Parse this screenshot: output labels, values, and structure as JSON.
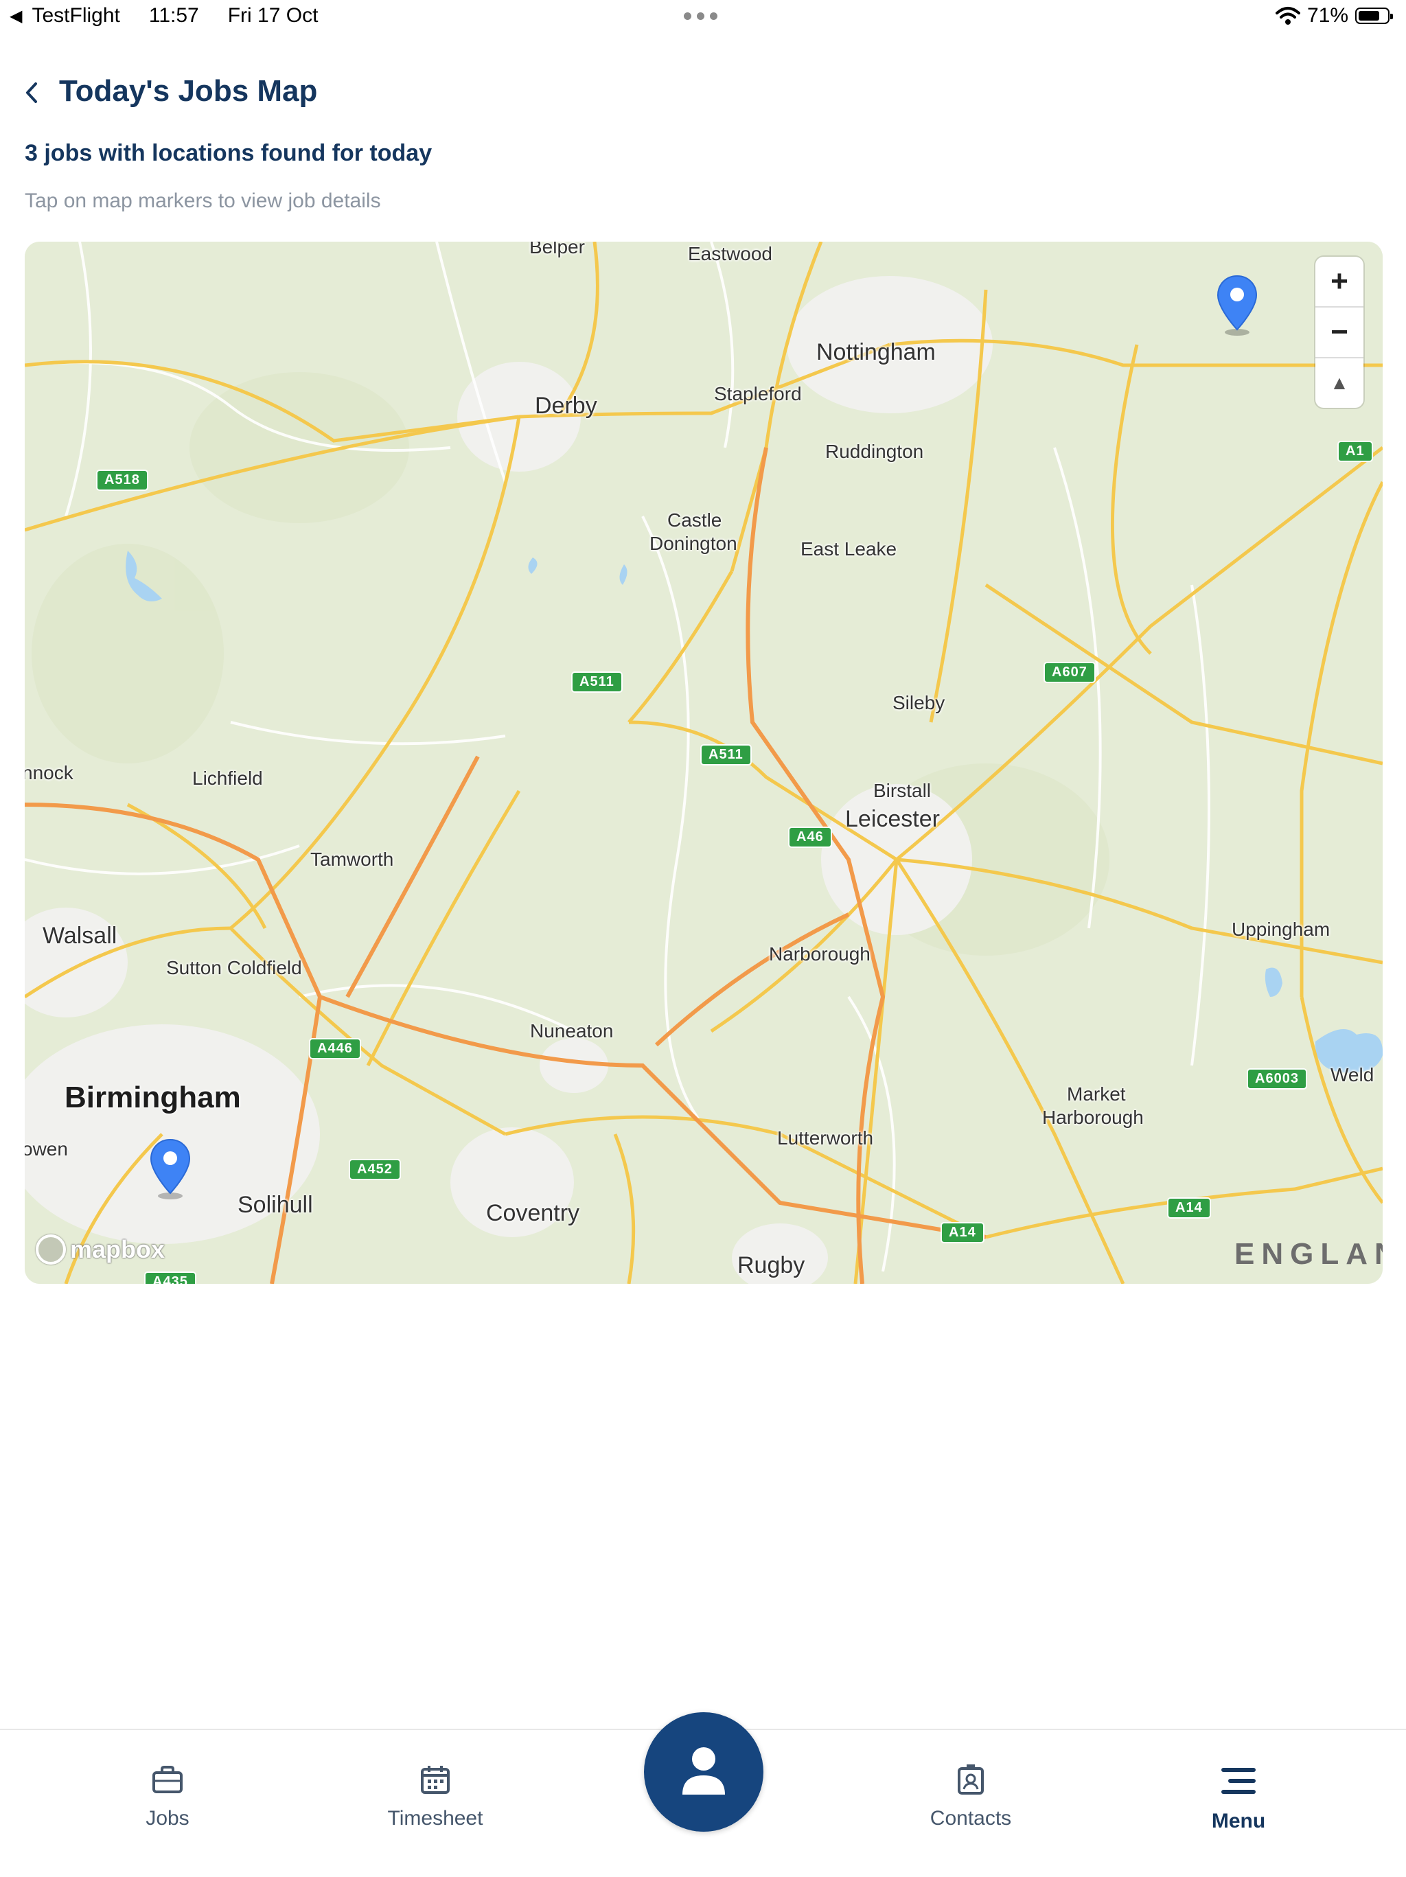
{
  "status_bar": {
    "back_app": "TestFlight",
    "time": "11:57",
    "date": "Fri 17 Oct",
    "battery": "71%",
    "icons": [
      "back-triangle-icon",
      "more-dots-icon",
      "wifi-icon",
      "battery-icon"
    ]
  },
  "header": {
    "title": "Today's Jobs Map",
    "back_icon": "chevron-left-icon"
  },
  "summary": {
    "count_text": "3 jobs with locations found for today",
    "hint": "Tap on map markers to view job details"
  },
  "map": {
    "labels": {
      "belper": "Belper",
      "eastwood": "Eastwood",
      "nottingham": "Nottingham",
      "derby": "Derby",
      "stapleford": "Stapleford",
      "ruddington": "Ruddington",
      "castle": "Castle",
      "donington": "Donington",
      "east_leake": "East Leake",
      "sileby": "Sileby",
      "nnock": "nnock",
      "lichfield": "Lichfield",
      "birstall": "Birstall",
      "leicester": "Leicester",
      "tamworth": "Tamworth",
      "walsall": "Walsall",
      "uppingham": "Uppingham",
      "sutton_coldfield": "Sutton Coldfield",
      "narborough": "Narborough",
      "nuneaton": "Nuneaton",
      "birmingham": "Birmingham",
      "market": "Market",
      "harborough": "Harborough",
      "weld": "Weld",
      "owen": "owen",
      "lutterworth": "Lutterworth",
      "solihull": "Solihull",
      "coventry": "Coventry",
      "rugby": "Rugby",
      "england": "ENGLAN"
    },
    "roads": {
      "a518": "A518",
      "a511_1": "A511",
      "a511_2": "A511",
      "a607": "A607",
      "a1": "A1",
      "a46": "A46",
      "a446": "A446",
      "a452": "A452",
      "a6003": "A6003",
      "a14_1": "A14",
      "a14_2": "A14",
      "a435": "A435"
    },
    "markers": [
      "map-pin-icon",
      "map-pin-icon"
    ],
    "zoom_in": "+",
    "zoom_out": "−",
    "compass": "▲",
    "attribution": "mapbox",
    "colors": {
      "land": "#e5ecd6",
      "motorway": "#f0b94a",
      "primary": "#f4c84d",
      "trunk": "#f29a4a",
      "water": "#a9d3f2",
      "marker": "#3e83f5"
    }
  },
  "tabbar": {
    "tabs": [
      {
        "label": "Jobs",
        "icon": "briefcase-icon"
      },
      {
        "label": "Timesheet",
        "icon": "calendar-icon"
      },
      {
        "label": "Contacts",
        "icon": "contact-card-icon"
      },
      {
        "label": "Menu",
        "icon": "menu-icon"
      }
    ],
    "center_icon": "user-icon",
    "active_tab": "Menu",
    "accent": "#16457e"
  }
}
